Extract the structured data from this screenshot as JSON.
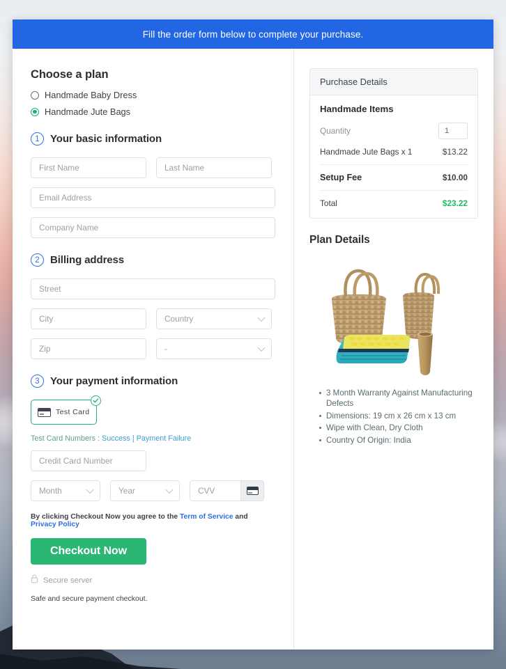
{
  "banner": {
    "text": "Fill the order form below to complete your purchase."
  },
  "plan": {
    "heading": "Choose a plan",
    "options": [
      {
        "label": "Handmade Baby Dress",
        "selected": false
      },
      {
        "label": "Handmade Jute Bags",
        "selected": true
      }
    ]
  },
  "steps": {
    "basic": {
      "number": "1",
      "label": "Your basic information"
    },
    "billing": {
      "number": "2",
      "label": "Billing address"
    },
    "payment": {
      "number": "3",
      "label": "Your payment information"
    }
  },
  "basic_fields": {
    "first_name": {
      "placeholder": "First Name",
      "value": ""
    },
    "last_name": {
      "placeholder": "Last Name",
      "value": ""
    },
    "email": {
      "placeholder": "Email Address",
      "value": ""
    },
    "company": {
      "placeholder": "Company Name",
      "value": ""
    }
  },
  "billing_fields": {
    "street": {
      "placeholder": "Street",
      "value": ""
    },
    "city": {
      "placeholder": "City",
      "value": ""
    },
    "country": {
      "placeholder": "Country",
      "value": "Country"
    },
    "zip": {
      "placeholder": "Zip",
      "value": ""
    },
    "state": {
      "placeholder": "-",
      "value": "-"
    }
  },
  "payment": {
    "test_card_label": "Test  Card",
    "card_icon": "credit-card-icon",
    "check_icon": "check-circle-icon",
    "test_numbers_prefix": "Test Card Numbers :",
    "success_link": "Success",
    "separator": "|",
    "failure_link": "Payment Failure",
    "credit_card": {
      "placeholder": "Credit Card Number",
      "value": ""
    },
    "month": {
      "placeholder": "Month",
      "value": "Month"
    },
    "year": {
      "placeholder": "Year",
      "value": "Year"
    },
    "cvv": {
      "placeholder": "CVV",
      "value": ""
    },
    "cvv_icon": "credit-card-icon"
  },
  "terms": {
    "prefix": "By clicking Checkout Now you agree to the",
    "tos_link": "Term of Service",
    "conjunction": "and",
    "privacy_link": "Privacy Policy"
  },
  "actions": {
    "checkout_label": "Checkout Now",
    "secure_label": "Secure server",
    "lock_icon": "lock-icon",
    "safe_note": "Safe and secure payment checkout."
  },
  "purchase_details": {
    "header": "Purchase Details",
    "items_title": "Handmade Items",
    "quantity_label": "Quantity",
    "quantity_value": "1",
    "line_items": [
      {
        "label": "Handmade Jute Bags x 1",
        "amount": "$13.22"
      }
    ],
    "setup_fee_label": "Setup Fee",
    "setup_fee_amount": "$10.00",
    "total_label": "Total",
    "total_amount": "$23.22"
  },
  "plan_details": {
    "title": "Plan Details",
    "product_image": "jute-bags-product-photo",
    "bullets": [
      "3 Month Warranty Against Manufacturing Defects",
      "Dimensions: 19 cm x 26 cm x 13 cm",
      "Wipe with Clean, Dry Cloth",
      "Country Of Origin: India"
    ]
  },
  "colors": {
    "banner_blue": "#2266e3",
    "accent_green": "#2bb673",
    "total_green": "#1fbb63",
    "step_blue": "#2d6fe0",
    "link_blue": "#3c9fd6"
  }
}
